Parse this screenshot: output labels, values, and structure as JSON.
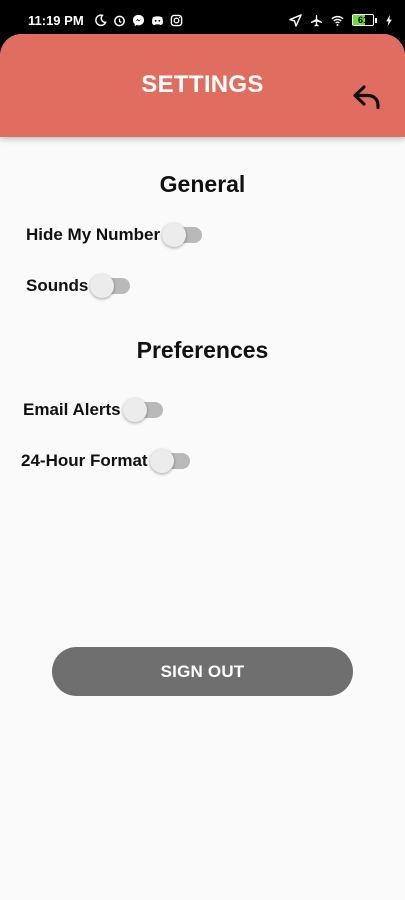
{
  "status_bar": {
    "time": "11:19 PM",
    "battery_level": "61",
    "battery_fraction": 0.61,
    "left_icons": [
      "moon-icon",
      "alarm-icon",
      "messenger-icon",
      "discord-icon",
      "instagram-icon"
    ],
    "right_icons": [
      "location-icon",
      "airplane-icon",
      "wifi-icon",
      "battery-icon",
      "charging-icon"
    ]
  },
  "header": {
    "title": "SETTINGS",
    "back_icon": "back-arrow-icon",
    "background": "#df6e60"
  },
  "sections": {
    "general": {
      "title": "General",
      "items": [
        {
          "label": "Hide My Number",
          "enabled": false
        },
        {
          "label": "Sounds",
          "enabled": false
        }
      ]
    },
    "preferences": {
      "title": "Preferences",
      "items": [
        {
          "label": "Email Alerts",
          "enabled": false
        },
        {
          "label": "24-Hour Format",
          "enabled": false
        }
      ]
    }
  },
  "signout_button": {
    "label": "SIGN OUT",
    "background": "#6f6f6f"
  }
}
